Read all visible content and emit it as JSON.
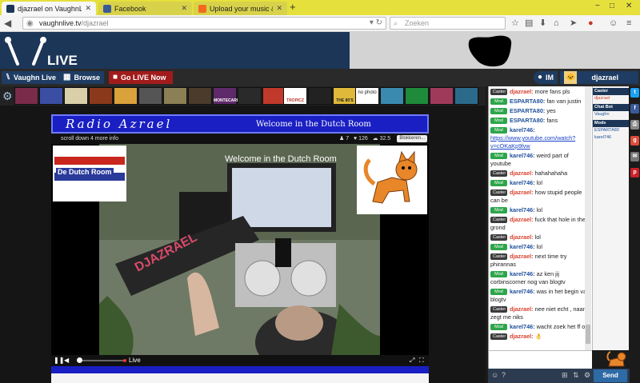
{
  "browser": {
    "tabs": [
      {
        "title": "djazrael on VaughnLive...",
        "active": true,
        "icon": "vaughnlive-favicon"
      },
      {
        "title": "Facebook",
        "active": false,
        "icon": "facebook-favicon"
      },
      {
        "title": "Upload your music & audi...",
        "active": false,
        "icon": "soundcloud-favicon"
      }
    ],
    "new_tab": "+",
    "window_controls": {
      "minimize": "−",
      "maximize": "□",
      "close": "✕"
    },
    "url_host": "vaughnlive.tv",
    "url_path": "/djazrael",
    "search_placeholder": "Zoeken"
  },
  "site": {
    "logo_text": "LIVE",
    "nav": {
      "vaughn_live": "Vaughn Live",
      "browse": "Browse",
      "go_live": "Go LIVE Now",
      "im": "IM",
      "username": "djazrael"
    },
    "thumbnails": [
      "",
      "",
      "",
      "",
      "",
      "",
      "",
      "",
      "",
      "",
      "",
      "",
      "",
      "",
      "",
      "",
      "",
      "",
      "",
      ""
    ],
    "thumb_labels": {
      "nophoto": "no photo",
      "montecarlo": "MONTECARLO",
      "tropicz": "TROPICZ",
      "the80s": "THE 80'S"
    }
  },
  "stream": {
    "banner_title": "Radio Azrael",
    "banner_subtitle": "Welcome in the Dutch Room",
    "scroll_text": "scroll down 4 more info",
    "likes": "7",
    "favorites": "126",
    "viewers": "32.5",
    "block_button": "Blokkeren...",
    "overlay_title": "Welcome in the Dutch Room",
    "dutch_room_label": "De Dutch Room",
    "live_label": "Live"
  },
  "chat": {
    "messages": [
      {
        "role": "Caster",
        "user": "djazrael:",
        "text": "more fans pls"
      },
      {
        "role": "Mod",
        "user": "ESPARTA80:",
        "text": "fan van justin"
      },
      {
        "role": "Mod",
        "user": "ESPARTA80:",
        "text": "yes"
      },
      {
        "role": "Mod",
        "user": "ESPARTA80:",
        "text": "fans"
      },
      {
        "role": "Mod",
        "user": "karel746:",
        "text": "https://www.youtube.com/watch?v=cOKaKp9lvw",
        "link": true
      },
      {
        "role": "Mod",
        "user": "karel746:",
        "text": "weird part of youtube"
      },
      {
        "role": "Caster",
        "user": "djazrael:",
        "text": "hahahahaha"
      },
      {
        "role": "Mod",
        "user": "karel746:",
        "text": "lol"
      },
      {
        "role": "Caster",
        "user": "djazrael:",
        "text": "how stupid people can be"
      },
      {
        "role": "Mod",
        "user": "karel746:",
        "text": "lol"
      },
      {
        "role": "Caster",
        "user": "djazrael:",
        "text": "fuck that hole in the grond"
      },
      {
        "role": "Caster",
        "user": "djazrael:",
        "text": "lol"
      },
      {
        "role": "Mod",
        "user": "karel746:",
        "text": "lol"
      },
      {
        "role": "Caster",
        "user": "djazrael:",
        "text": "next time try phirannas"
      },
      {
        "role": "Mod",
        "user": "karel746:",
        "text": "az ken jij corbinscorner nog van blogtv"
      },
      {
        "role": "Mod",
        "user": "karel746:",
        "text": "was in het begin van blogtv"
      },
      {
        "role": "Caster",
        "user": "djazrael:",
        "text": "nee niet echt , naam zegt me niks"
      },
      {
        "role": "Mod",
        "user": "karel746:",
        "text": "wacht zoek het ff op"
      },
      {
        "role": "Caster",
        "user": "djazrael:",
        "text": "👌"
      }
    ],
    "send_label": "Send"
  },
  "userlist": {
    "sections": [
      {
        "header": "Caster",
        "users": [
          {
            "name": "djazrael",
            "kind": "caster"
          }
        ]
      },
      {
        "header": "Chat Bot",
        "users": [
          {
            "name": "Vaughn",
            "kind": "other"
          }
        ]
      },
      {
        "header": "Mods",
        "users": [
          {
            "name": "ESPARTA80",
            "kind": "other"
          },
          {
            "name": "karel746",
            "kind": "other"
          }
        ]
      }
    ]
  },
  "social": [
    "twitter-icon",
    "facebook-icon",
    "print-icon",
    "googleplus-icon",
    "email-icon",
    "pinterest-icon"
  ],
  "colors": {
    "header_navy": "#1c3658",
    "tab_yellow": "#e6e03c",
    "go_live_red": "#a11b1b",
    "mod_green": "#2da54a",
    "caster_dark": "#3a3a3a",
    "caster_name": "#d8412f",
    "mod_name": "#1f4f9a",
    "banner_blue": "#1a1fc4"
  }
}
